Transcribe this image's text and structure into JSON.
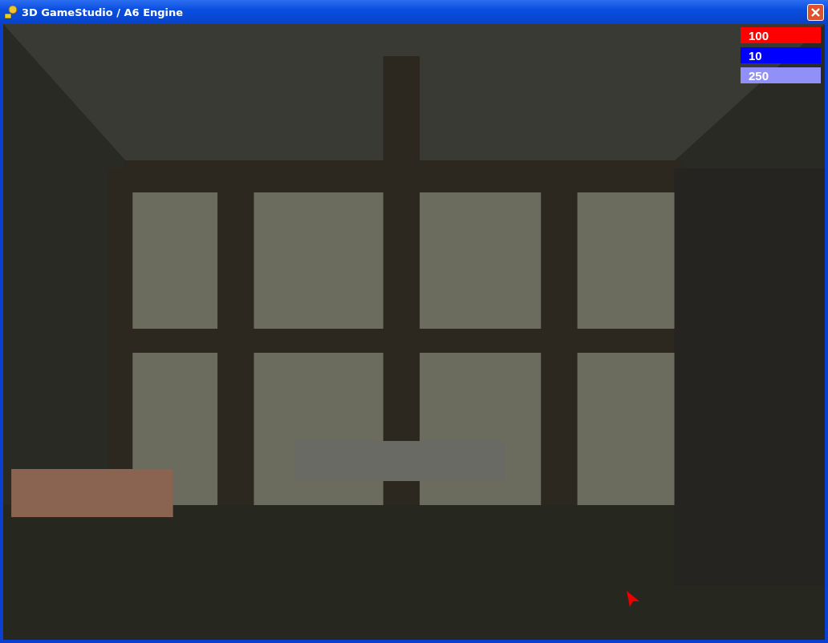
{
  "window": {
    "title": "3D GameStudio / A6 Engine"
  },
  "hud": [
    {
      "value": "100",
      "color": "#ff0000"
    },
    {
      "value": "10",
      "color": "#0000ff"
    },
    {
      "value": "250",
      "color": "#9090f8"
    }
  ]
}
